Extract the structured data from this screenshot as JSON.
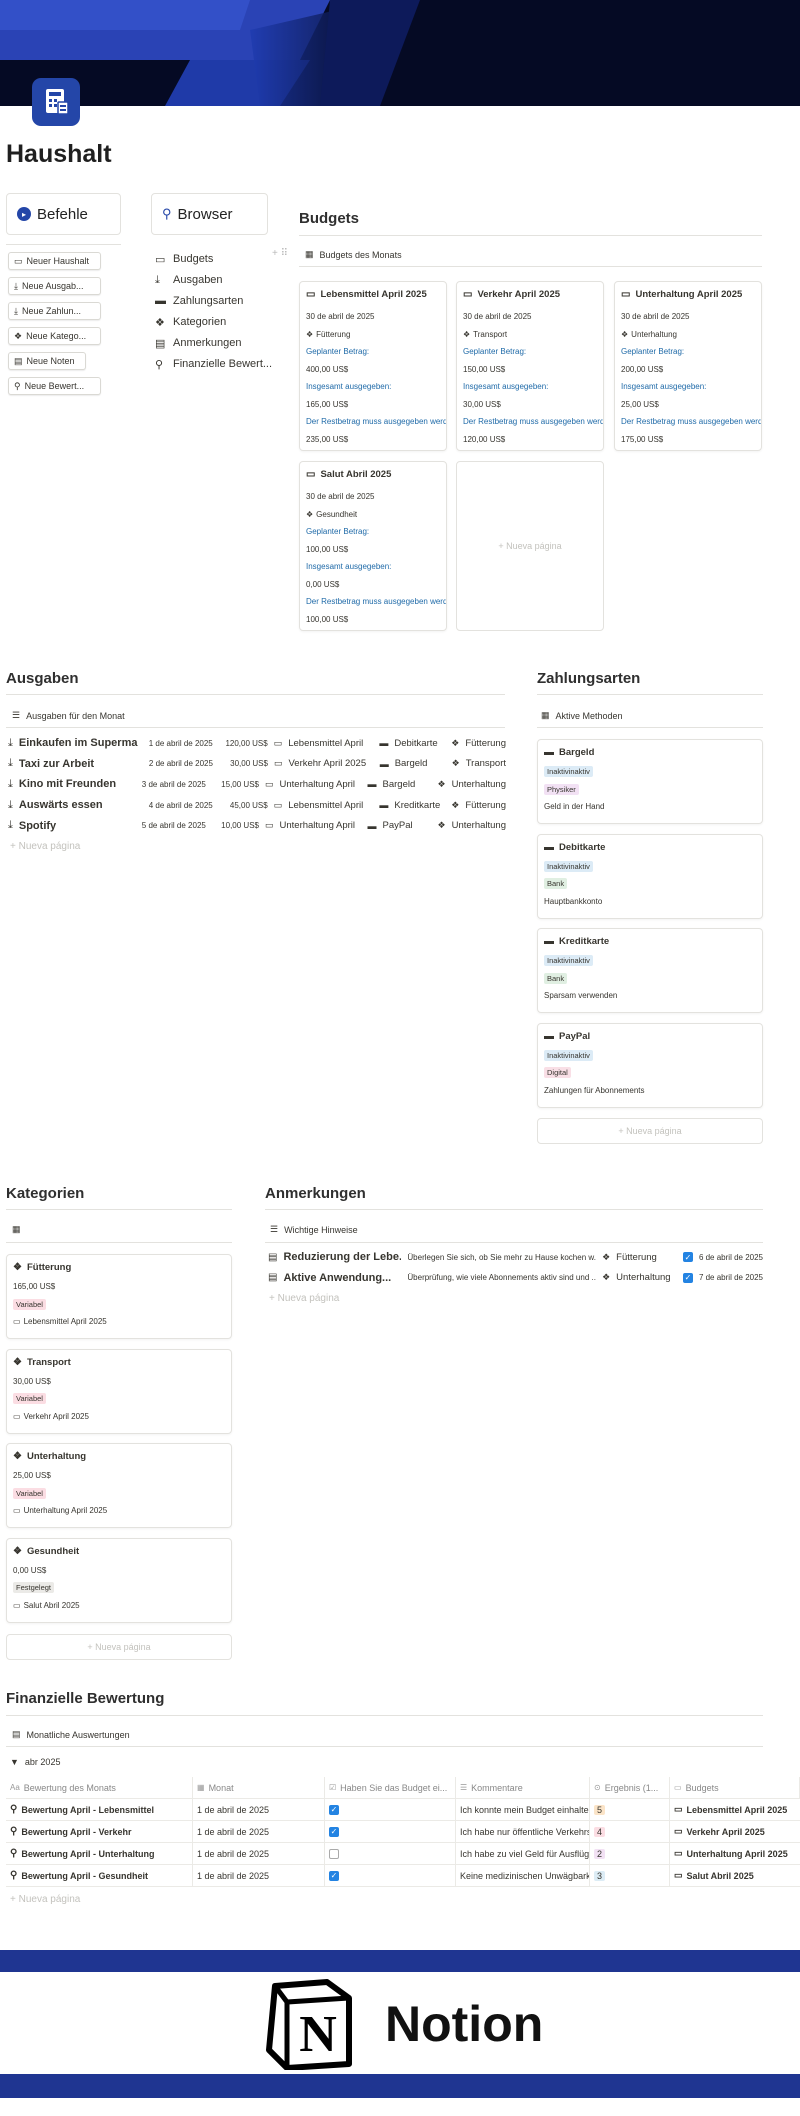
{
  "page": {
    "title": "Haushalt"
  },
  "befehle": {
    "label": "Befehle",
    "items": [
      "Neuer Haushalt",
      "Neue Ausgab...",
      "Neue Zahlun...",
      "Neue Katego...",
      "Neue Noten",
      "Neue Bewert..."
    ]
  },
  "browser": {
    "label": "Browser",
    "items": [
      "Budgets",
      "Ausgaben",
      "Zahlungsarten",
      "Kategorien",
      "Anmerkungen",
      "Finanzielle Bewert..."
    ]
  },
  "budgets": {
    "heading": "Budgets",
    "view": "Budgets des Monats",
    "new_page": "Nueva página",
    "cards": [
      {
        "title": "Lebensmittel April 2025",
        "date": "30 de abril de 2025",
        "cat": "Fütterung",
        "planned_label": "Geplanter Betrag:",
        "planned": "400,00 US$",
        "spent_label": "Insgesamt ausgegeben:",
        "spent": "165,00 US$",
        "rest_label": "Der Restbetrag muss ausgegeben werden",
        "rest": "235,00 US$"
      },
      {
        "title": "Verkehr April 2025",
        "date": "30 de abril de 2025",
        "cat": "Transport",
        "planned_label": "Geplanter Betrag:",
        "planned": "150,00 US$",
        "spent_label": "Insgesamt ausgegeben:",
        "spent": "30,00 US$",
        "rest_label": "Der Restbetrag muss ausgegeben werden",
        "rest": "120,00 US$"
      },
      {
        "title": "Unterhaltung April 2025",
        "date": "30 de abril de 2025",
        "cat": "Unterhaltung",
        "planned_label": "Geplanter Betrag:",
        "planned": "200,00 US$",
        "spent_label": "Insgesamt ausgegeben:",
        "spent": "25,00 US$",
        "rest_label": "Der Restbetrag muss ausgegeben werden",
        "rest": "175,00 US$"
      },
      {
        "title": "Salut Abril 2025",
        "date": "30 de abril de 2025",
        "cat": "Gesundheit",
        "planned_label": "Geplanter Betrag:",
        "planned": "100,00 US$",
        "spent_label": "Insgesamt ausgegeben:",
        "spent": "0,00 US$",
        "rest_label": "Der Restbetrag muss ausgegeben werden",
        "rest": "100,00 US$"
      }
    ]
  },
  "ausgaben": {
    "heading": "Ausgaben",
    "view": "Ausgaben für den Monat",
    "new_page": "Nueva página",
    "rows": [
      {
        "name": "Einkaufen im Superma...",
        "date": "1 de abril de 2025",
        "amount": "120,00 US$",
        "budget": "Lebensmittel April",
        "method": "Debitkarte",
        "cat": "Fütterung"
      },
      {
        "name": "Taxi zur Arbeit",
        "date": "2 de abril de 2025",
        "amount": "30,00 US$",
        "budget": "Verkehr April 2025",
        "method": "Bargeld",
        "cat": "Transport"
      },
      {
        "name": "Kino mit Freunden",
        "date": "3 de abril de 2025",
        "amount": "15,00 US$",
        "budget": "Unterhaltung April",
        "method": "Bargeld",
        "cat": "Unterhaltung"
      },
      {
        "name": "Auswärts essen",
        "date": "4 de abril de 2025",
        "amount": "45,00 US$",
        "budget": "Lebensmittel April",
        "method": "Kreditkarte",
        "cat": "Fütterung"
      },
      {
        "name": "Spotify",
        "date": "5 de abril de 2025",
        "amount": "10,00 US$",
        "budget": "Unterhaltung April",
        "method": "PayPal",
        "cat": "Unterhaltung"
      }
    ]
  },
  "zahlungsarten": {
    "heading": "Zahlungsarten",
    "view": "Aktive Methoden",
    "new_page": "Nueva página",
    "cards": [
      {
        "title": "Bargeld",
        "status": "Inaktivinaktiv",
        "type": "Physiker",
        "type_color": "#f2e1f4",
        "desc": "Geld in der Hand"
      },
      {
        "title": "Debitkarte",
        "status": "Inaktivinaktiv",
        "type": "Bank",
        "type_color": "#e0efe2",
        "desc": "Hauptbankkonto"
      },
      {
        "title": "Kreditkarte",
        "status": "Inaktivinaktiv",
        "type": "Bank",
        "type_color": "#e0efe2",
        "desc": "Sparsam verwenden"
      },
      {
        "title": "PayPal",
        "status": "Inaktivinaktiv",
        "type": "Digital",
        "type_color": "#f9dfe6",
        "desc": "Zahlungen für Abonnements"
      }
    ]
  },
  "kategorien": {
    "heading": "Kategorien",
    "new_page": "Nueva página",
    "cards": [
      {
        "title": "Fütterung",
        "amount": "165,00 US$",
        "tag": "Variabel",
        "tag_color": "#fbdde3",
        "budget": "Lebensmittel April 2025"
      },
      {
        "title": "Transport",
        "amount": "30,00 US$",
        "tag": "Variabel",
        "tag_color": "#fbdde3",
        "budget": "Verkehr April 2025"
      },
      {
        "title": "Unterhaltung",
        "amount": "25,00 US$",
        "tag": "Variabel",
        "tag_color": "#fbdde3",
        "budget": "Unterhaltung April 2025"
      },
      {
        "title": "Gesundheit",
        "amount": "0,00 US$",
        "tag": "Festgelegt",
        "tag_color": "#ebeae7",
        "budget": "Salut Abril 2025"
      }
    ]
  },
  "anmerkungen": {
    "heading": "Anmerkungen",
    "view": "Wichtige Hinweise",
    "new_page": "Nueva página",
    "rows": [
      {
        "title": "Reduzierung der Lebe...",
        "text": "Überlegen Sie sich, ob Sie mehr zu Hause kochen w...",
        "cat": "Fütterung",
        "date": "6 de abril de 2025"
      },
      {
        "title": "Aktive Anwendung...",
        "text": "Überprüfung, wie viele Abonnements aktiv sind und ...",
        "cat": "Unterhaltung",
        "date": "7 de abril de 2025"
      }
    ]
  },
  "bewertung": {
    "heading": "Finanzielle Bewertung",
    "view": "Monatliche Auswertungen",
    "group": "abr 2025",
    "new_page": "Nueva página",
    "columns": [
      "Bewertung des Monats",
      "Monat",
      "Haben Sie das Budget ei...",
      "Kommentare",
      "Ergebnis (1...",
      "Budgets"
    ],
    "rows": [
      {
        "name": "Bewertung April - Lebensmittel",
        "month": "1 de abril de 2025",
        "checked": true,
        "comment": "Ich konnte mein Budget einhalten",
        "score": "5",
        "score_color": "#fbe4c8",
        "budget": "Lebensmittel April 2025"
      },
      {
        "name": "Bewertung April - Verkehr",
        "month": "1 de abril de 2025",
        "checked": true,
        "comment": "Ich habe nur öffentliche Verkehrsmittel",
        "score": "4",
        "score_color": "#fbdde3",
        "budget": "Verkehr April 2025"
      },
      {
        "name": "Bewertung April - Unterhaltung",
        "month": "1 de abril de 2025",
        "checked": false,
        "comment": "Ich habe zu viel Geld für Ausflüge",
        "score": "2",
        "score_color": "#f2e1f4",
        "budget": "Unterhaltung April 2025"
      },
      {
        "name": "Bewertung April - Gesundheit",
        "month": "1 de abril de 2025",
        "checked": true,
        "comment": "Keine medizinischen Unwägbarkeiten",
        "score": "3",
        "score_color": "#dcecf5",
        "budget": "Salut Abril 2025"
      }
    ]
  },
  "footer": {
    "brand": "Notion",
    "logo_letter": "N"
  },
  "colors": {
    "accent": "#1f3591",
    "banner_dark": "#050a24",
    "link_blue": "#1f6aa8"
  }
}
